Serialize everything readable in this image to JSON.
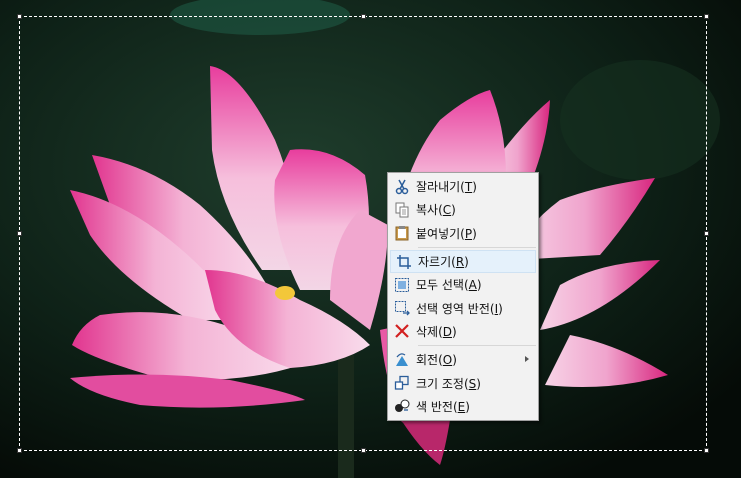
{
  "menu": {
    "items": [
      {
        "label": "잘라내기",
        "key": "T",
        "icon": "scissors-icon"
      },
      {
        "label": "복사",
        "key": "C",
        "icon": "copy-icon"
      },
      {
        "label": "붙여넣기",
        "key": "P",
        "icon": "clipboard-icon"
      },
      {
        "label": "자르기",
        "key": "R",
        "icon": "crop-icon",
        "highlighted": true
      },
      {
        "label": "모두 선택",
        "key": "A",
        "icon": "select-all-icon"
      },
      {
        "label": "선택 영역 반전",
        "key": "I",
        "icon": "invert-selection-icon"
      },
      {
        "label": "삭제",
        "key": "D",
        "icon": "delete-icon"
      },
      {
        "label": "회전",
        "key": "O",
        "icon": "rotate-icon",
        "submenu": true
      },
      {
        "label": "크기 조정",
        "key": "S",
        "icon": "resize-icon"
      },
      {
        "label": "색 반전",
        "key": "E",
        "icon": "invert-color-icon"
      }
    ]
  }
}
